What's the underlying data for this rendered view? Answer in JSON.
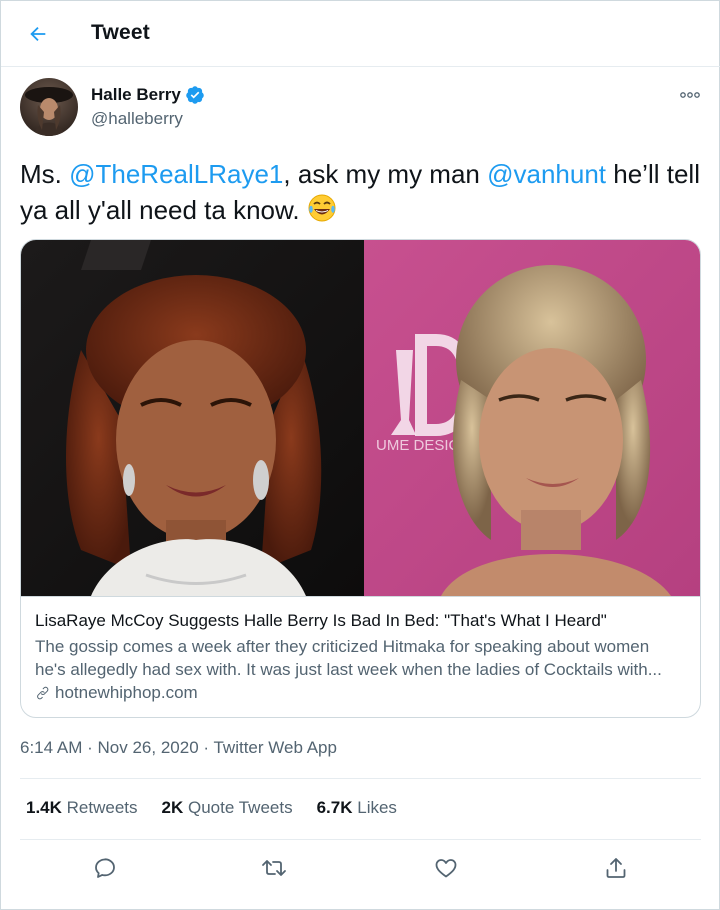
{
  "header": {
    "title": "Tweet",
    "back_icon": "arrow-left-icon",
    "accent_color": "#1d9bf0"
  },
  "author": {
    "name": "Halle Berry",
    "handle": "@halleberry",
    "verified": true
  },
  "tweet": {
    "text_parts": [
      {
        "type": "text",
        "value": "Ms. "
      },
      {
        "type": "mention",
        "value": "@TheRealLRaye1"
      },
      {
        "type": "text",
        "value": ", ask my my man "
      },
      {
        "type": "mention",
        "value": "@vanhunt"
      },
      {
        "type": "text",
        "value": " he’ll tell ya all y'all need ta know. "
      }
    ],
    "emoji": "😂"
  },
  "card": {
    "title": "LisaRaye McCoy Suggests Halle Berry Is Bad In Bed: \"That's What I Heard\"",
    "description_line1": "The gossip comes a week after they criticized Hitmaka for speaking about women",
    "description_line2": "he's allegedly had sex with. It was just last week when the ladies of Cocktails with...",
    "domain": "hotnewhiphop.com",
    "image_backdrop_text": "UME DESIGN"
  },
  "meta": {
    "time": "6:14 AM",
    "separator": "·",
    "date": "Nov 26, 2020",
    "source": "Twitter Web App"
  },
  "stats": {
    "retweets_count": "1.4K",
    "retweets_label": "Retweets",
    "quotes_count": "2K",
    "quotes_label": "Quote Tweets",
    "likes_count": "6.7K",
    "likes_label": "Likes"
  },
  "actions": [
    "reply-icon",
    "retweet-icon",
    "like-icon",
    "share-icon"
  ],
  "colors": {
    "text": "#0f1419",
    "secondary": "#536471",
    "border": "#cfd9de",
    "link": "#1d9bf0"
  }
}
